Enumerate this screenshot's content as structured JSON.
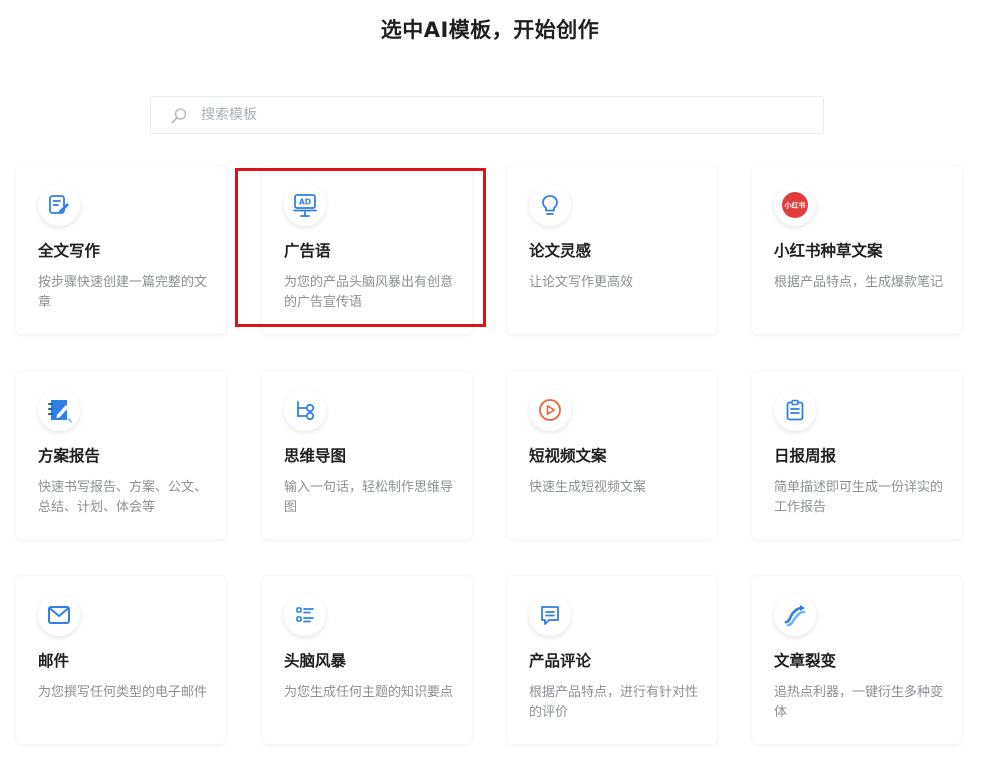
{
  "page": {
    "title": "选中AI模板，开始创作"
  },
  "search": {
    "placeholder": "搜索模板",
    "value": ""
  },
  "templates": [
    {
      "title": "全文写作",
      "desc": "按步骤快速创建一篇完整的文章",
      "icon": "edit-document-icon"
    },
    {
      "title": "广告语",
      "desc": "为您的产品头脑风暴出有创意的广告宣传语",
      "icon": "ad-board-icon"
    },
    {
      "title": "论文灵感",
      "desc": "让论文写作更高效",
      "icon": "lightbulb-icon"
    },
    {
      "title": "小红书种草文案",
      "desc": "根据产品特点，生成爆款笔记",
      "icon": "xiaohongshu-logo-icon",
      "logo_text": "小红书"
    },
    {
      "title": "方案报告",
      "desc": "快速书写报告、方案、公文、总结、计划、体会等",
      "icon": "notebook-pen-icon"
    },
    {
      "title": "思维导图",
      "desc": "输入一句话，轻松制作思维导图",
      "icon": "mind-map-icon"
    },
    {
      "title": "短视频文案",
      "desc": "快速生成短视频文案",
      "icon": "video-play-icon"
    },
    {
      "title": "日报周报",
      "desc": "简单描述即可生成一份详实的工作报告",
      "icon": "clipboard-icon"
    },
    {
      "title": "邮件",
      "desc": "为您撰写任何类型的电子邮件",
      "icon": "mail-icon"
    },
    {
      "title": "头脑风暴",
      "desc": "为您生成任何主题的知识要点",
      "icon": "list-icon"
    },
    {
      "title": "产品评论",
      "desc": "根据产品特点，进行有针对性的评价",
      "icon": "comment-icon"
    },
    {
      "title": "文章裂变",
      "desc": "追热点利器，一键衍生多种变体",
      "icon": "split-arrows-icon"
    }
  ],
  "colors": {
    "accent": "#2f7fe6",
    "highlight": "#d9141a",
    "xiaohongshu": "#e03c3c"
  }
}
